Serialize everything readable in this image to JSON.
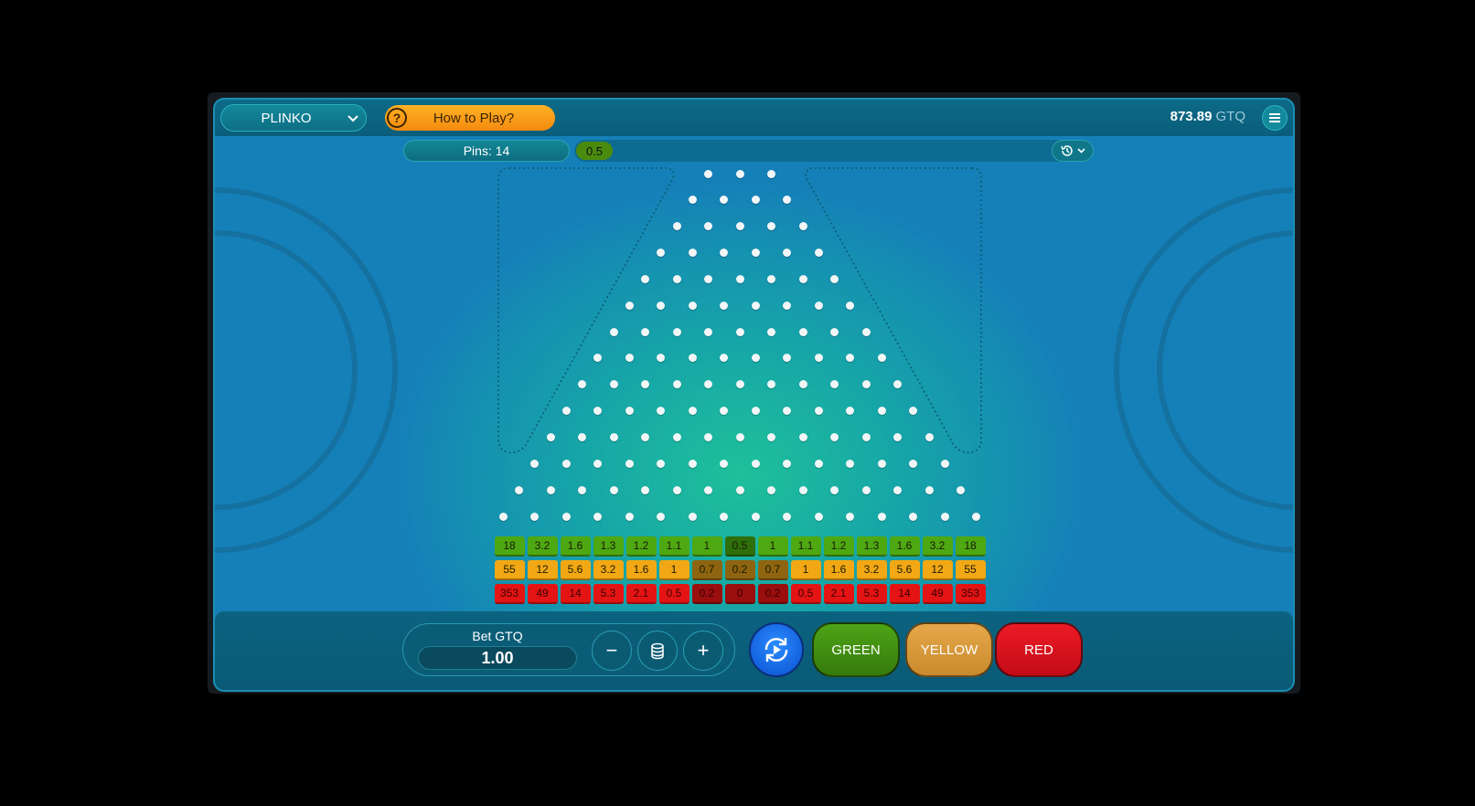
{
  "topbar": {
    "game_name": "PLINKO",
    "how_to_play": "How to Play?",
    "balance_amount": "873.89",
    "balance_currency": "GTQ"
  },
  "controls": {
    "pins_label": "Pins: 14",
    "history": [
      "0.5"
    ]
  },
  "board": {
    "rows": 14,
    "multipliers": {
      "green": [
        "18",
        "3.2",
        "1.6",
        "1.3",
        "1.2",
        "1.1",
        "1",
        "0.5",
        "1",
        "1.1",
        "1.2",
        "1.3",
        "1.6",
        "3.2",
        "18"
      ],
      "yellow": [
        "55",
        "12",
        "5.6",
        "3.2",
        "1.6",
        "1",
        "0.7",
        "0.2",
        "0.7",
        "1",
        "1.6",
        "3.2",
        "5.6",
        "12",
        "55"
      ],
      "red": [
        "353",
        "49",
        "14",
        "5.3",
        "2.1",
        "0.5",
        "0.2",
        "0",
        "0.2",
        "0.5",
        "2.1",
        "5.3",
        "14",
        "49",
        "353"
      ]
    }
  },
  "bet": {
    "label": "Bet GTQ",
    "value": "1.00",
    "minus": "−",
    "plus": "+"
  },
  "buttons": {
    "green": "GREEN",
    "yellow": "YELLOW",
    "red": "RED"
  },
  "colors": {
    "green_bright": "#4ea812",
    "green_dark": "#2e6f0c",
    "yellow_bright": "#f2a814",
    "yellow_dark": "#8f6410",
    "red_bright": "#e51414",
    "red_dark": "#9a0e0e",
    "auto_button": "#1f6fe8",
    "green_button": "#3f8f12",
    "yellow_button": "#d99b3c",
    "red_button": "#e0101e"
  },
  "icons": {
    "menu": "hamburger-icon",
    "help": "question-icon",
    "history": "history-clock-icon",
    "coins": "coin-stack-icon",
    "autoplay": "autoplay-icon"
  }
}
